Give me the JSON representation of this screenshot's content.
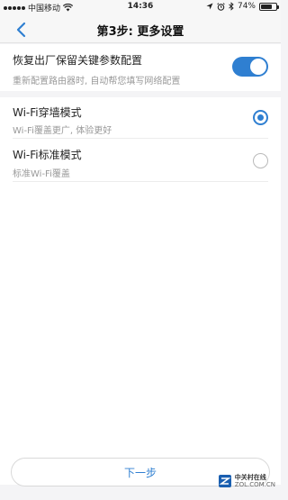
{
  "status_bar": {
    "carrier": "中国移动",
    "time": "14:36",
    "battery": "74%",
    "battery_level": 0.74,
    "icons": [
      "signal-icon",
      "wifi-icon",
      "location-icon",
      "alarm-icon",
      "bluetooth-icon",
      "battery-icon"
    ]
  },
  "nav": {
    "title": "第3步: 更多设置",
    "back_icon": "chevron-left-icon"
  },
  "restore_setting": {
    "title": "恢复出厂保留关键参数配置",
    "subtitle": "重新配置路由器时, 自动帮您填写网络配置",
    "enabled": true
  },
  "modes": [
    {
      "title": "Wi-Fi穿墙模式",
      "subtitle": "Wi-Fi覆盖更广, 体验更好",
      "selected": true
    },
    {
      "title": "Wi-Fi标准模式",
      "subtitle": "标准Wi-Fi覆盖",
      "selected": false
    }
  ],
  "footer": {
    "next_label": "下一步"
  },
  "watermark": {
    "name": "中关村在线",
    "domain": "ZOL.COM.CN"
  },
  "colors": {
    "accent": "#2f7fd1",
    "background": "#f4f4f6"
  }
}
